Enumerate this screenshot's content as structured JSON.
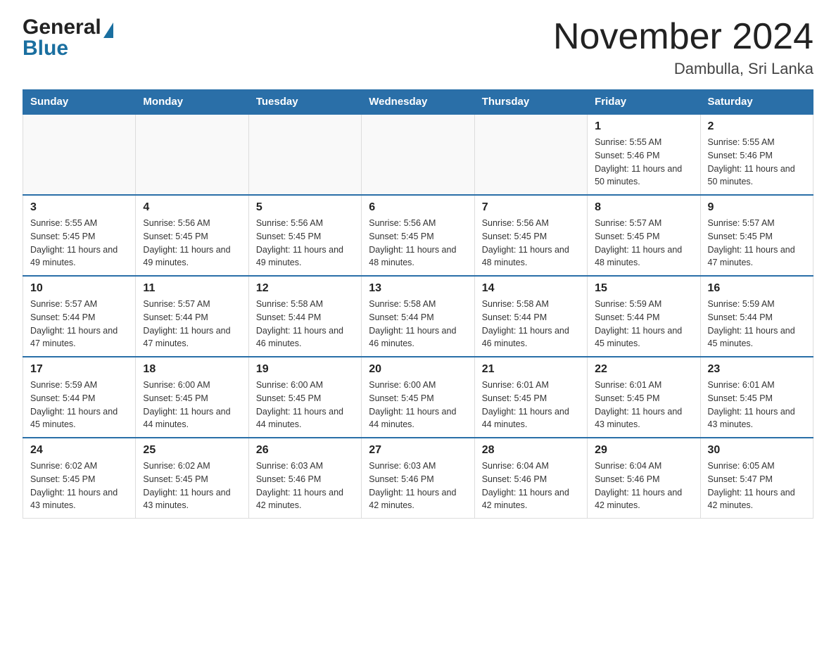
{
  "header": {
    "logo_general": "General",
    "logo_blue": "Blue",
    "month_year": "November 2024",
    "location": "Dambulla, Sri Lanka"
  },
  "calendar": {
    "days_of_week": [
      "Sunday",
      "Monday",
      "Tuesday",
      "Wednesday",
      "Thursday",
      "Friday",
      "Saturday"
    ],
    "weeks": [
      [
        {
          "day": "",
          "sunrise": "",
          "sunset": "",
          "daylight": ""
        },
        {
          "day": "",
          "sunrise": "",
          "sunset": "",
          "daylight": ""
        },
        {
          "day": "",
          "sunrise": "",
          "sunset": "",
          "daylight": ""
        },
        {
          "day": "",
          "sunrise": "",
          "sunset": "",
          "daylight": ""
        },
        {
          "day": "",
          "sunrise": "",
          "sunset": "",
          "daylight": ""
        },
        {
          "day": "1",
          "sunrise": "Sunrise: 5:55 AM",
          "sunset": "Sunset: 5:46 PM",
          "daylight": "Daylight: 11 hours and 50 minutes."
        },
        {
          "day": "2",
          "sunrise": "Sunrise: 5:55 AM",
          "sunset": "Sunset: 5:46 PM",
          "daylight": "Daylight: 11 hours and 50 minutes."
        }
      ],
      [
        {
          "day": "3",
          "sunrise": "Sunrise: 5:55 AM",
          "sunset": "Sunset: 5:45 PM",
          "daylight": "Daylight: 11 hours and 49 minutes."
        },
        {
          "day": "4",
          "sunrise": "Sunrise: 5:56 AM",
          "sunset": "Sunset: 5:45 PM",
          "daylight": "Daylight: 11 hours and 49 minutes."
        },
        {
          "day": "5",
          "sunrise": "Sunrise: 5:56 AM",
          "sunset": "Sunset: 5:45 PM",
          "daylight": "Daylight: 11 hours and 49 minutes."
        },
        {
          "day": "6",
          "sunrise": "Sunrise: 5:56 AM",
          "sunset": "Sunset: 5:45 PM",
          "daylight": "Daylight: 11 hours and 48 minutes."
        },
        {
          "day": "7",
          "sunrise": "Sunrise: 5:56 AM",
          "sunset": "Sunset: 5:45 PM",
          "daylight": "Daylight: 11 hours and 48 minutes."
        },
        {
          "day": "8",
          "sunrise": "Sunrise: 5:57 AM",
          "sunset": "Sunset: 5:45 PM",
          "daylight": "Daylight: 11 hours and 48 minutes."
        },
        {
          "day": "9",
          "sunrise": "Sunrise: 5:57 AM",
          "sunset": "Sunset: 5:45 PM",
          "daylight": "Daylight: 11 hours and 47 minutes."
        }
      ],
      [
        {
          "day": "10",
          "sunrise": "Sunrise: 5:57 AM",
          "sunset": "Sunset: 5:44 PM",
          "daylight": "Daylight: 11 hours and 47 minutes."
        },
        {
          "day": "11",
          "sunrise": "Sunrise: 5:57 AM",
          "sunset": "Sunset: 5:44 PM",
          "daylight": "Daylight: 11 hours and 47 minutes."
        },
        {
          "day": "12",
          "sunrise": "Sunrise: 5:58 AM",
          "sunset": "Sunset: 5:44 PM",
          "daylight": "Daylight: 11 hours and 46 minutes."
        },
        {
          "day": "13",
          "sunrise": "Sunrise: 5:58 AM",
          "sunset": "Sunset: 5:44 PM",
          "daylight": "Daylight: 11 hours and 46 minutes."
        },
        {
          "day": "14",
          "sunrise": "Sunrise: 5:58 AM",
          "sunset": "Sunset: 5:44 PM",
          "daylight": "Daylight: 11 hours and 46 minutes."
        },
        {
          "day": "15",
          "sunrise": "Sunrise: 5:59 AM",
          "sunset": "Sunset: 5:44 PM",
          "daylight": "Daylight: 11 hours and 45 minutes."
        },
        {
          "day": "16",
          "sunrise": "Sunrise: 5:59 AM",
          "sunset": "Sunset: 5:44 PM",
          "daylight": "Daylight: 11 hours and 45 minutes."
        }
      ],
      [
        {
          "day": "17",
          "sunrise": "Sunrise: 5:59 AM",
          "sunset": "Sunset: 5:44 PM",
          "daylight": "Daylight: 11 hours and 45 minutes."
        },
        {
          "day": "18",
          "sunrise": "Sunrise: 6:00 AM",
          "sunset": "Sunset: 5:45 PM",
          "daylight": "Daylight: 11 hours and 44 minutes."
        },
        {
          "day": "19",
          "sunrise": "Sunrise: 6:00 AM",
          "sunset": "Sunset: 5:45 PM",
          "daylight": "Daylight: 11 hours and 44 minutes."
        },
        {
          "day": "20",
          "sunrise": "Sunrise: 6:00 AM",
          "sunset": "Sunset: 5:45 PM",
          "daylight": "Daylight: 11 hours and 44 minutes."
        },
        {
          "day": "21",
          "sunrise": "Sunrise: 6:01 AM",
          "sunset": "Sunset: 5:45 PM",
          "daylight": "Daylight: 11 hours and 44 minutes."
        },
        {
          "day": "22",
          "sunrise": "Sunrise: 6:01 AM",
          "sunset": "Sunset: 5:45 PM",
          "daylight": "Daylight: 11 hours and 43 minutes."
        },
        {
          "day": "23",
          "sunrise": "Sunrise: 6:01 AM",
          "sunset": "Sunset: 5:45 PM",
          "daylight": "Daylight: 11 hours and 43 minutes."
        }
      ],
      [
        {
          "day": "24",
          "sunrise": "Sunrise: 6:02 AM",
          "sunset": "Sunset: 5:45 PM",
          "daylight": "Daylight: 11 hours and 43 minutes."
        },
        {
          "day": "25",
          "sunrise": "Sunrise: 6:02 AM",
          "sunset": "Sunset: 5:45 PM",
          "daylight": "Daylight: 11 hours and 43 minutes."
        },
        {
          "day": "26",
          "sunrise": "Sunrise: 6:03 AM",
          "sunset": "Sunset: 5:46 PM",
          "daylight": "Daylight: 11 hours and 42 minutes."
        },
        {
          "day": "27",
          "sunrise": "Sunrise: 6:03 AM",
          "sunset": "Sunset: 5:46 PM",
          "daylight": "Daylight: 11 hours and 42 minutes."
        },
        {
          "day": "28",
          "sunrise": "Sunrise: 6:04 AM",
          "sunset": "Sunset: 5:46 PM",
          "daylight": "Daylight: 11 hours and 42 minutes."
        },
        {
          "day": "29",
          "sunrise": "Sunrise: 6:04 AM",
          "sunset": "Sunset: 5:46 PM",
          "daylight": "Daylight: 11 hours and 42 minutes."
        },
        {
          "day": "30",
          "sunrise": "Sunrise: 6:05 AM",
          "sunset": "Sunset: 5:47 PM",
          "daylight": "Daylight: 11 hours and 42 minutes."
        }
      ]
    ]
  }
}
